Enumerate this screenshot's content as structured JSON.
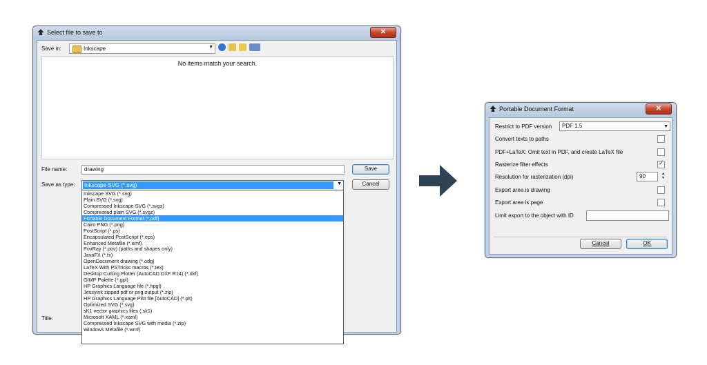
{
  "file_dialog": {
    "title": "Select file to save to",
    "save_in_label": "Save in:",
    "save_in_value": "Inkscape",
    "empty_message": "No items match your search.",
    "file_name_label": "File name:",
    "file_name_value": "drawing",
    "save_as_type_label": "Save as type:",
    "save_as_type_value": "Inkscape SVG (*.svg)",
    "title_label": "Title:",
    "save_button": "Save",
    "cancel_button": "Cancel",
    "type_options": [
      "Inkscape SVG (*.svg)",
      "Plain SVG (*.svg)",
      "Compressed Inkscape SVG (*.svgz)",
      "Compressed plain SVG (*.svgz)",
      "Portable Document Format (*.pdf)",
      "Cairo PNG (*.png)",
      "PostScript (*.ps)",
      "Encapsulated PostScript (*.eps)",
      "Enhanced Metafile (*.emf)",
      "PovRay (*.pov) (paths and shapes only)",
      "JavaFX (*.fx)",
      "OpenDocument drawing (*.odg)",
      "LaTeX With PSTricks macros (*.tex)",
      "Desktop Cutting Plotter (AutoCAD DXF R14) (*.dxf)",
      "GIMP Palette (*.gpl)",
      "HP Graphics Language file (*.hpgl)",
      "Jessyink zipped pdf or png output (*.zip)",
      "HP Graphics Language Plot file [AutoCAD] (*.plt)",
      "Optimized SVG (*.svg)",
      "sK1 vector graphics files (.sk1)",
      "Microsoft XAML (*.xaml)",
      "Compressed Inkscape SVG with media (*.zip)",
      "Windows Metafile (*.wmf)"
    ],
    "selected_option_index": 4
  },
  "pdf_dialog": {
    "title": "Portable Document Format",
    "restrict_label": "Restrict to PDF version",
    "restrict_value": "PDF 1.5",
    "convert_texts_label": "Convert texts to paths",
    "convert_texts_checked": false,
    "latex_label": "PDF+LaTeX: Omit text in PDF, and create LaTeX file",
    "latex_checked": false,
    "rasterize_label": "Rasterize filter effects",
    "rasterize_checked": true,
    "resolution_label": "Resolution for rasterization (dpi)",
    "resolution_value": "90",
    "export_drawing_label": "Export area is drawing",
    "export_drawing_checked": false,
    "export_page_label": "Export area is page",
    "export_page_checked": false,
    "limit_label": "Limit export to the object with ID",
    "limit_value": "",
    "cancel_button": "Cancel",
    "ok_button": "OK"
  },
  "colors": {
    "arrow": "#2e4353",
    "selection": "#3399ff",
    "close_button": "#c8462d"
  },
  "icons": {
    "app": "inkscape-icon",
    "folder": "folder-icon",
    "arrow": "arrow-right-icon"
  }
}
